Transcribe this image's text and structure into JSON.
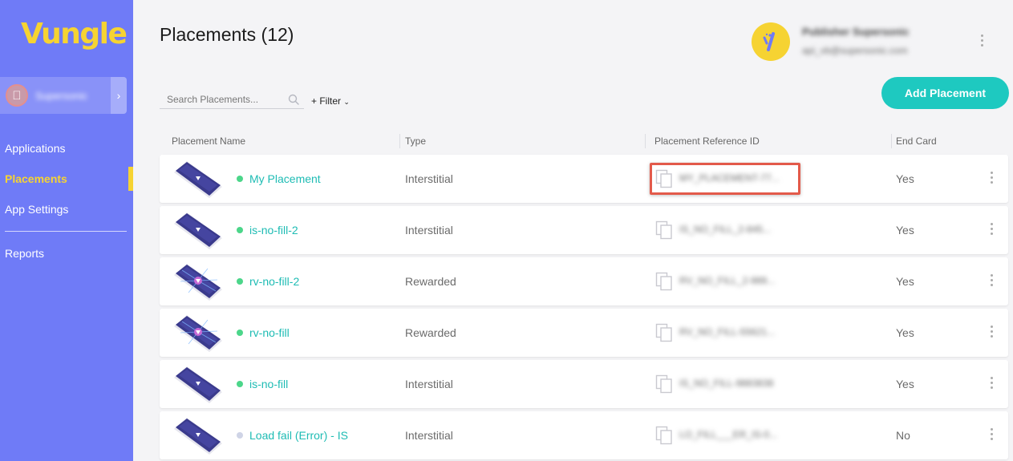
{
  "sidebar": {
    "logo": "Vungle",
    "app_name": "Supersonic",
    "items": [
      {
        "label": "Applications"
      },
      {
        "label": "Placements"
      },
      {
        "label": "App Settings"
      },
      {
        "label": "Reports"
      }
    ],
    "active_item": "Placements"
  },
  "header": {
    "title": "Placements (12)",
    "user_name": "Publisher Supersonic",
    "user_email": "api_vb@supersonic.com"
  },
  "search": {
    "placeholder": "Search Placements..."
  },
  "filter_label": "+ Filter",
  "add_button_label": "Add Placement",
  "table": {
    "columns": [
      "Placement Name",
      "Type",
      "Placement Reference ID",
      "End Card"
    ],
    "rows": [
      {
        "name": "My Placement",
        "type": "Interstitial",
        "ref_id": "MY_PLACEMENT-77...",
        "end_card": "Yes",
        "status": "active",
        "art": "interstitial"
      },
      {
        "name": "is-no-fill-2",
        "type": "Interstitial",
        "ref_id": "IS_NO_FILL_2-845...",
        "end_card": "Yes",
        "status": "active",
        "art": "interstitial"
      },
      {
        "name": "rv-no-fill-2",
        "type": "Rewarded",
        "ref_id": "RV_NO_FILL_2-989...",
        "end_card": "Yes",
        "status": "active",
        "art": "rewarded"
      },
      {
        "name": "rv-no-fill",
        "type": "Rewarded",
        "ref_id": "RV_NO_FILL-55621...",
        "end_card": "Yes",
        "status": "active",
        "art": "rewarded"
      },
      {
        "name": "is-no-fill",
        "type": "Interstitial",
        "ref_id": "IS_NO_FILL-9883838",
        "end_card": "Yes",
        "status": "active",
        "art": "interstitial"
      },
      {
        "name": "Load fail (Error) - IS",
        "type": "Interstitial",
        "ref_id": "LO_FILL___ER_IS-0...",
        "end_card": "No",
        "status": "inactive",
        "art": "interstitial"
      }
    ]
  },
  "colors": {
    "sidebar_bg": "#6f7bf7",
    "accent_yellow": "#f6d332",
    "teal": "#1ec9c0",
    "status_active": "#4cd68a",
    "status_inactive": "#cfd4e6",
    "highlight": "#e35a4a"
  },
  "icons": [
    "apple-icon",
    "chevron-right-icon",
    "search-icon",
    "copy-icon",
    "more-vert-icon",
    "chevron-down-icon"
  ]
}
